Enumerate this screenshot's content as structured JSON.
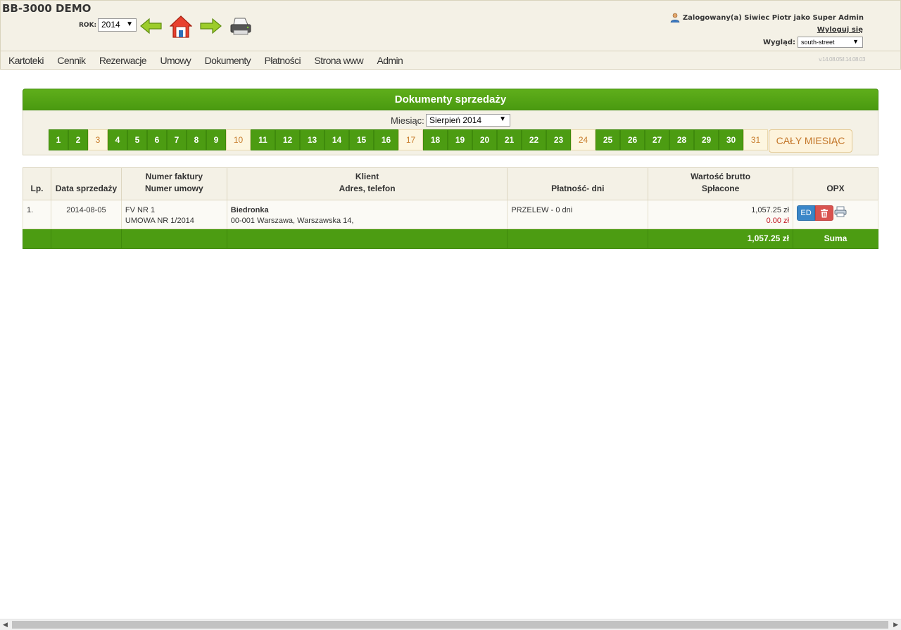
{
  "app": {
    "title": "BB-3000 DEMO"
  },
  "header": {
    "rok_label": "ROK:",
    "rok_value": "2014",
    "user_text": "Zalogowany(a) Siwiec Piotr jako Super Admin",
    "logout_label": "Wyloguj się",
    "wyglad_label": "Wygląd:",
    "wyglad_value": "south-street"
  },
  "menu": {
    "items": [
      "Kartoteki",
      "Cennik",
      "Rezerwacje",
      "Umowy",
      "Dokumenty",
      "Płatności",
      "Strona www",
      "Admin"
    ],
    "version": "v.14.08.05/l.14.08.03"
  },
  "panel": {
    "title": "Dokumenty sprzedaży",
    "miesiac_label": "Miesiąc:",
    "miesiac_value": "Sierpień 2014",
    "days": [
      {
        "n": "1",
        "weekend": false
      },
      {
        "n": "2",
        "weekend": false
      },
      {
        "n": "3",
        "weekend": true
      },
      {
        "n": "4",
        "weekend": false
      },
      {
        "n": "5",
        "weekend": false
      },
      {
        "n": "6",
        "weekend": false
      },
      {
        "n": "7",
        "weekend": false
      },
      {
        "n": "8",
        "weekend": false
      },
      {
        "n": "9",
        "weekend": false
      },
      {
        "n": "10",
        "weekend": true
      },
      {
        "n": "11",
        "weekend": false
      },
      {
        "n": "12",
        "weekend": false
      },
      {
        "n": "13",
        "weekend": false
      },
      {
        "n": "14",
        "weekend": false
      },
      {
        "n": "15",
        "weekend": false
      },
      {
        "n": "16",
        "weekend": false
      },
      {
        "n": "17",
        "weekend": true
      },
      {
        "n": "18",
        "weekend": false
      },
      {
        "n": "19",
        "weekend": false
      },
      {
        "n": "20",
        "weekend": false
      },
      {
        "n": "21",
        "weekend": false
      },
      {
        "n": "22",
        "weekend": false
      },
      {
        "n": "23",
        "weekend": false
      },
      {
        "n": "24",
        "weekend": true
      },
      {
        "n": "25",
        "weekend": false
      },
      {
        "n": "26",
        "weekend": false
      },
      {
        "n": "27",
        "weekend": false
      },
      {
        "n": "28",
        "weekend": false
      },
      {
        "n": "29",
        "weekend": false
      },
      {
        "n": "30",
        "weekend": false
      },
      {
        "n": "31",
        "weekend": true
      }
    ],
    "all_month_label": "CAŁY MIESIĄC"
  },
  "table": {
    "headers": {
      "lp": "Lp.",
      "date": "Data sprzedaży",
      "num_1": "Numer faktury",
      "num_2": "Numer umowy",
      "client_1": "Klient",
      "client_2": "Adres, telefon",
      "pay": "Płatność- dni",
      "val_1": "Wartość brutto",
      "val_2": "Spłacone",
      "opx": "OPX"
    },
    "rows": [
      {
        "lp": "1.",
        "date": "2014-08-05",
        "invoice": "FV NR 1",
        "contract": "UMOWA NR 1/2014",
        "client": "Biedronka",
        "address": "00-001 Warszawa, Warszawska 14,",
        "payment": "PRZELEW - 0 dni",
        "gross": "1,057.25 zł",
        "paid": "0.00 zł",
        "ed_label": "ED"
      }
    ],
    "sum": {
      "total": "1,057.25 zł",
      "label": "Suma"
    }
  }
}
